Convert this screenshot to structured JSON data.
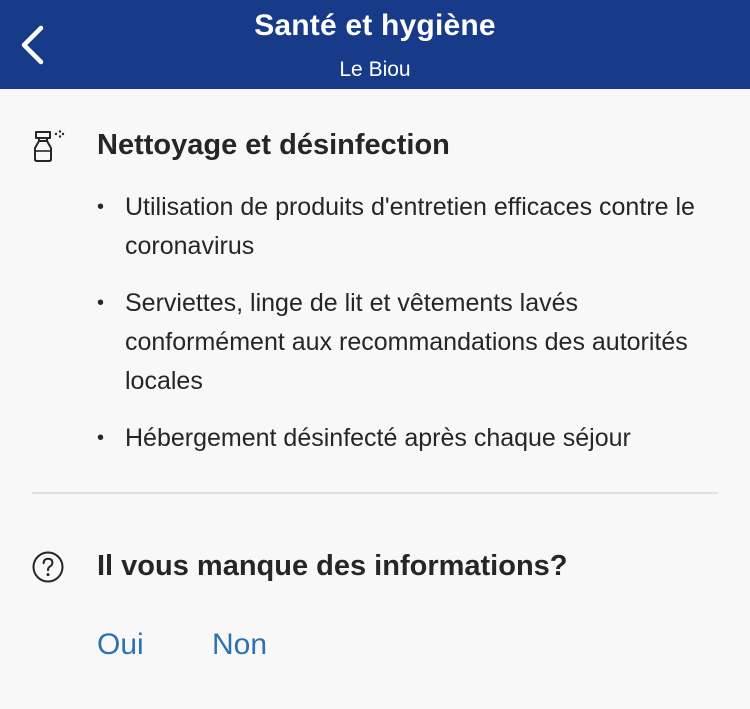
{
  "header": {
    "title": "Santé et hygiène",
    "subtitle": "Le Biou",
    "back_icon": "chevron-left-icon"
  },
  "cleaning": {
    "icon": "spray-bottle-icon",
    "title": "Nettoyage et désinfection",
    "items": [
      {
        "text": "Utilisation de produits d'entretien efficaces contre le coronavirus"
      },
      {
        "text": "Serviettes, linge de lit et vêtements lavés conformément aux recommandations des autorités locales"
      },
      {
        "text": "Hébergement désinfecté après chaque séjour"
      }
    ]
  },
  "feedback": {
    "icon": "question-circle-icon",
    "title": "Il vous manque des informations?",
    "yes_label": "Oui",
    "no_label": "Non"
  },
  "colors": {
    "header_bg": "#173b88",
    "link": "#2e70b4",
    "text": "#262626",
    "background": "#f8f8f8"
  }
}
